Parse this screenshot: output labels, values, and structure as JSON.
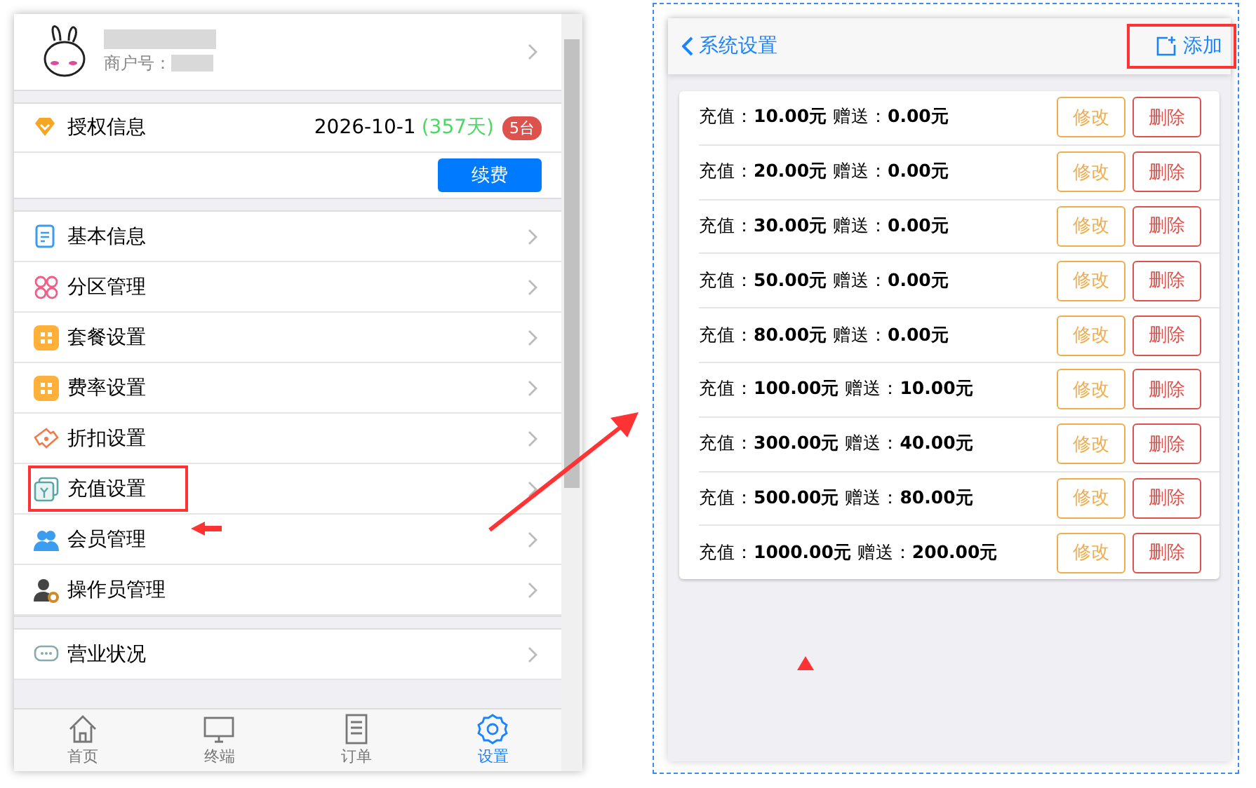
{
  "profile": {
    "merchant_label": "商户号："
  },
  "license": {
    "label": "授权信息",
    "date": "2026-10-1",
    "days": "(357天)",
    "devices": "5台",
    "renew_button": "续费"
  },
  "menu": [
    {
      "label": "基本信息",
      "kind": "document",
      "annotated": false
    },
    {
      "label": "分区管理",
      "kind": "clover",
      "annotated": false
    },
    {
      "label": "套餐设置",
      "kind": "grid",
      "annotated": false
    },
    {
      "label": "费率设置",
      "kind": "grid",
      "annotated": false
    },
    {
      "label": "折扣设置",
      "kind": "ticket",
      "annotated": false
    },
    {
      "label": "充值设置",
      "kind": "yen",
      "annotated": true
    },
    {
      "label": "会员管理",
      "kind": "users",
      "annotated": false
    },
    {
      "label": "操作员管理",
      "kind": "usergear",
      "annotated": false
    },
    {
      "label": "营业状况",
      "kind": "chat",
      "annotated": false,
      "group_start": true
    }
  ],
  "tabs": [
    {
      "label": "首页",
      "kind": "home",
      "selected": false
    },
    {
      "label": "终端",
      "kind": "monitor",
      "selected": false
    },
    {
      "label": "订单",
      "kind": "list",
      "selected": false
    },
    {
      "label": "设置",
      "kind": "gear",
      "selected": true
    }
  ],
  "header": {
    "back": "系统设置",
    "add": "添加",
    "add_annotated": true
  },
  "recharges": [
    {
      "text": "充值：**10.00元** 赠送：**0.00元**",
      "edit": "修改",
      "delete": "删除"
    },
    {
      "text": "充值：**20.00元** 赠送：**0.00元**",
      "edit": "修改",
      "delete": "删除"
    },
    {
      "text": "充值：**30.00元** 赠送：**0.00元**",
      "edit": "修改",
      "delete": "删除"
    },
    {
      "text": "充值：**50.00元** 赠送：**0.00元**",
      "edit": "修改",
      "delete": "删除"
    },
    {
      "text": "充值：**80.00元** 赠送：**0.00元**",
      "edit": "修改",
      "delete": "删除"
    },
    {
      "text": "充值：**100.00元** 赠送：**10.00元**",
      "edit": "修改",
      "delete": "删除"
    },
    {
      "text": "充值：**300.00元** 赠送：**40.00元**",
      "edit": "修改",
      "delete": "删除"
    },
    {
      "text": "充值：**500.00元** 赠送：**80.00元**",
      "edit": "修改",
      "delete": "删除"
    },
    {
      "text": "充值：**1000.00元** 赠送：**200.00元**",
      "edit": "修改",
      "delete": "删除"
    }
  ]
}
